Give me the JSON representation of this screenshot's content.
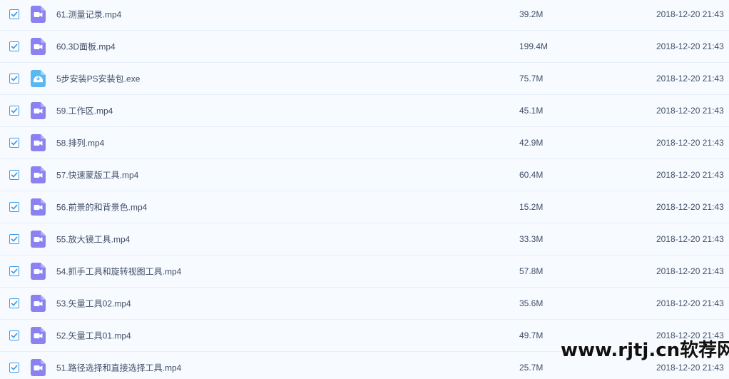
{
  "files": [
    {
      "name": "61.测量记录.mp4",
      "size": "39.2M",
      "date": "2018-12-20 21:43",
      "icon": "video-file-icon",
      "checked": true
    },
    {
      "name": "60.3D面板.mp4",
      "size": "199.4M",
      "date": "2018-12-20 21:43",
      "icon": "video-file-icon",
      "checked": true
    },
    {
      "name": "5步安装PS安装包.exe",
      "size": "75.7M",
      "date": "2018-12-20 21:43",
      "icon": "exe-file-icon",
      "checked": true
    },
    {
      "name": "59.工作区.mp4",
      "size": "45.1M",
      "date": "2018-12-20 21:43",
      "icon": "video-file-icon",
      "checked": true
    },
    {
      "name": "58.排列.mp4",
      "size": "42.9M",
      "date": "2018-12-20 21:43",
      "icon": "video-file-icon",
      "checked": true
    },
    {
      "name": "57.快速蒙版工具.mp4",
      "size": "60.4M",
      "date": "2018-12-20 21:43",
      "icon": "video-file-icon",
      "checked": true
    },
    {
      "name": "56.前景的和背景色.mp4",
      "size": "15.2M",
      "date": "2018-12-20 21:43",
      "icon": "video-file-icon",
      "checked": true
    },
    {
      "name": "55.放大镜工具.mp4",
      "size": "33.3M",
      "date": "2018-12-20 21:43",
      "icon": "video-file-icon",
      "checked": true
    },
    {
      "name": "54.抓手工具和旋转视图工具.mp4",
      "size": "57.8M",
      "date": "2018-12-20 21:43",
      "icon": "video-file-icon",
      "checked": true
    },
    {
      "name": "53.矢量工具02.mp4",
      "size": "35.6M",
      "date": "2018-12-20 21:43",
      "icon": "video-file-icon",
      "checked": true
    },
    {
      "name": "52.矢量工具01.mp4",
      "size": "49.7M",
      "date": "2018-12-20 21:43",
      "icon": "video-file-icon",
      "checked": true
    },
    {
      "name": "51.路径选择和直接选择工具.mp4",
      "size": "25.7M",
      "date": "2018-12-20 21:43",
      "icon": "video-file-icon",
      "checked": true
    }
  ],
  "watermark": "www.rjtj.cn软荐网",
  "colors": {
    "background": "#f7fbff",
    "row_divider": "#e6effa",
    "checkbox_accent": "#3b9ae8",
    "video_icon": "#8b82f1",
    "exe_icon": "#5ab7f2",
    "text": "#424e67"
  }
}
